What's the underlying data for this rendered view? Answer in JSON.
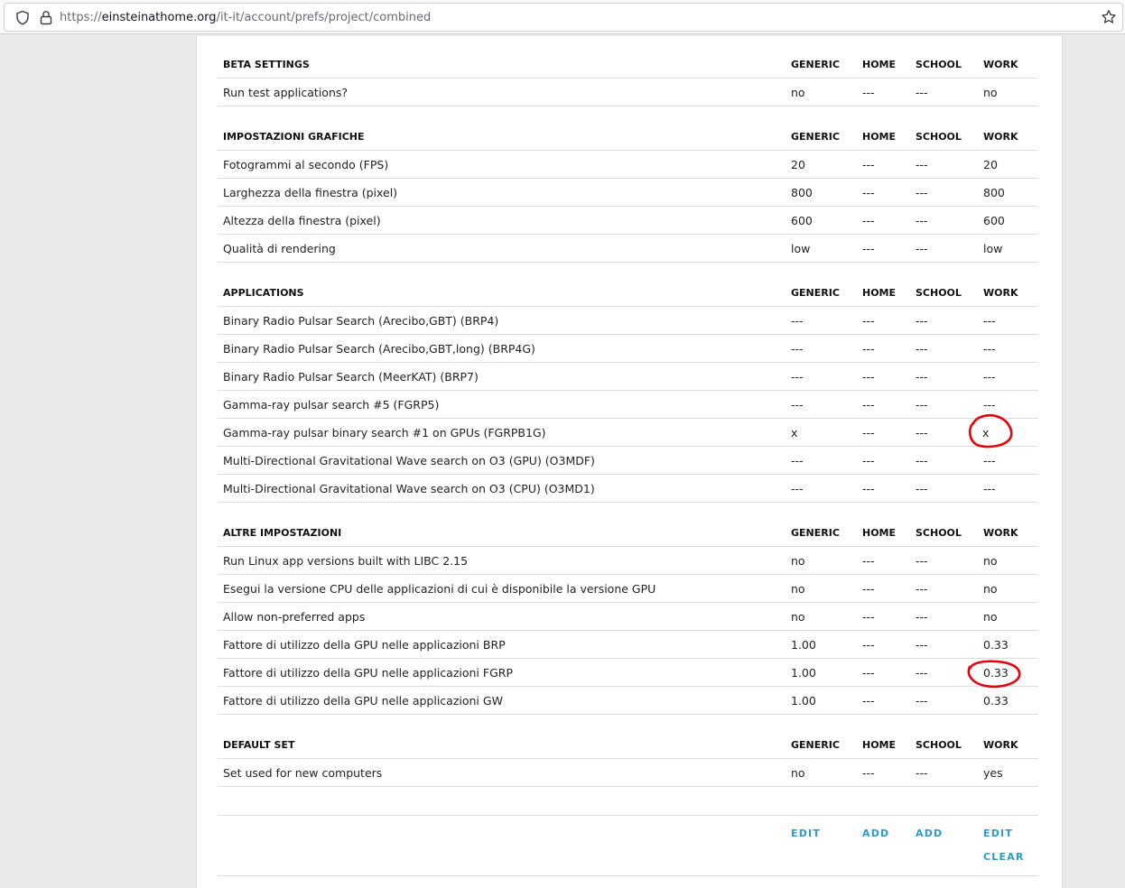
{
  "browser": {
    "url_prefix": "https://",
    "url_host": "einsteinathome.org",
    "url_path": "/it-it/account/prefs/project/combined"
  },
  "accent_color": "#2b9bcd",
  "annotation_color": "#e8000b",
  "columns": [
    "GENERIC",
    "HOME",
    "SCHOOL",
    "WORK"
  ],
  "sections": [
    {
      "title": "BETA SETTINGS",
      "rows": [
        {
          "label": "Run test applications?",
          "values": [
            "no",
            "---",
            "---",
            "no"
          ]
        }
      ]
    },
    {
      "title": "IMPOSTAZIONI GRAFICHE",
      "rows": [
        {
          "label": "Fotogrammi al secondo (FPS)",
          "values": [
            "20",
            "---",
            "---",
            "20"
          ]
        },
        {
          "label": "Larghezza della finestra (pixel)",
          "values": [
            "800",
            "---",
            "---",
            "800"
          ]
        },
        {
          "label": "Altezza della finestra (pixel)",
          "values": [
            "600",
            "---",
            "---",
            "600"
          ]
        },
        {
          "label": "Qualità di rendering",
          "values": [
            "low",
            "---",
            "---",
            "low"
          ]
        }
      ]
    },
    {
      "title": "APPLICATIONS",
      "rows": [
        {
          "label": "Binary Radio Pulsar Search (Arecibo,GBT) (BRP4)",
          "values": [
            "---",
            "---",
            "---",
            "---"
          ]
        },
        {
          "label": "Binary Radio Pulsar Search (Arecibo,GBT,long) (BRP4G)",
          "values": [
            "---",
            "---",
            "---",
            "---"
          ]
        },
        {
          "label": "Binary Radio Pulsar Search (MeerKAT) (BRP7)",
          "values": [
            "---",
            "---",
            "---",
            "---"
          ]
        },
        {
          "label": "Gamma-ray pulsar search #5 (FGRP5)",
          "values": [
            "---",
            "---",
            "---",
            "---"
          ]
        },
        {
          "label": "Gamma-ray pulsar binary search #1 on GPUs (FGRPB1G)",
          "values": [
            "x",
            "---",
            "---",
            "x"
          ]
        },
        {
          "label": "Multi-Directional Gravitational Wave search on O3 (GPU) (O3MDF)",
          "values": [
            "---",
            "---",
            "---",
            "---"
          ]
        },
        {
          "label": "Multi-Directional Gravitational Wave search on O3 (CPU) (O3MD1)",
          "values": [
            "---",
            "---",
            "---",
            "---"
          ]
        }
      ]
    },
    {
      "title": "ALTRE IMPOSTAZIONI",
      "rows": [
        {
          "label": "Run Linux app versions built with LIBC 2.15",
          "values": [
            "no",
            "---",
            "---",
            "no"
          ]
        },
        {
          "label": "Esegui la versione CPU delle applicazioni di cui è disponibile la versione GPU",
          "values": [
            "no",
            "---",
            "---",
            "no"
          ]
        },
        {
          "label": "Allow non-preferred apps",
          "values": [
            "no",
            "---",
            "---",
            "no"
          ]
        },
        {
          "label": "Fattore di utilizzo della GPU nelle applicazioni BRP",
          "values": [
            "1.00",
            "---",
            "---",
            "0.33"
          ]
        },
        {
          "label": "Fattore di utilizzo della GPU nelle applicazioni FGRP",
          "values": [
            "1.00",
            "---",
            "---",
            "0.33"
          ]
        },
        {
          "label": "Fattore di utilizzo della GPU nelle applicazioni GW",
          "values": [
            "1.00",
            "---",
            "---",
            "0.33"
          ]
        }
      ]
    },
    {
      "title": "DEFAULT SET",
      "rows": [
        {
          "label": "Set used for new computers",
          "values": [
            "no",
            "---",
            "---",
            "yes"
          ]
        }
      ]
    }
  ],
  "actions": {
    "generic_edit": "EDIT",
    "home_add": "ADD",
    "school_add": "ADD",
    "work_edit": "EDIT",
    "work_clear": "CLEAR"
  }
}
